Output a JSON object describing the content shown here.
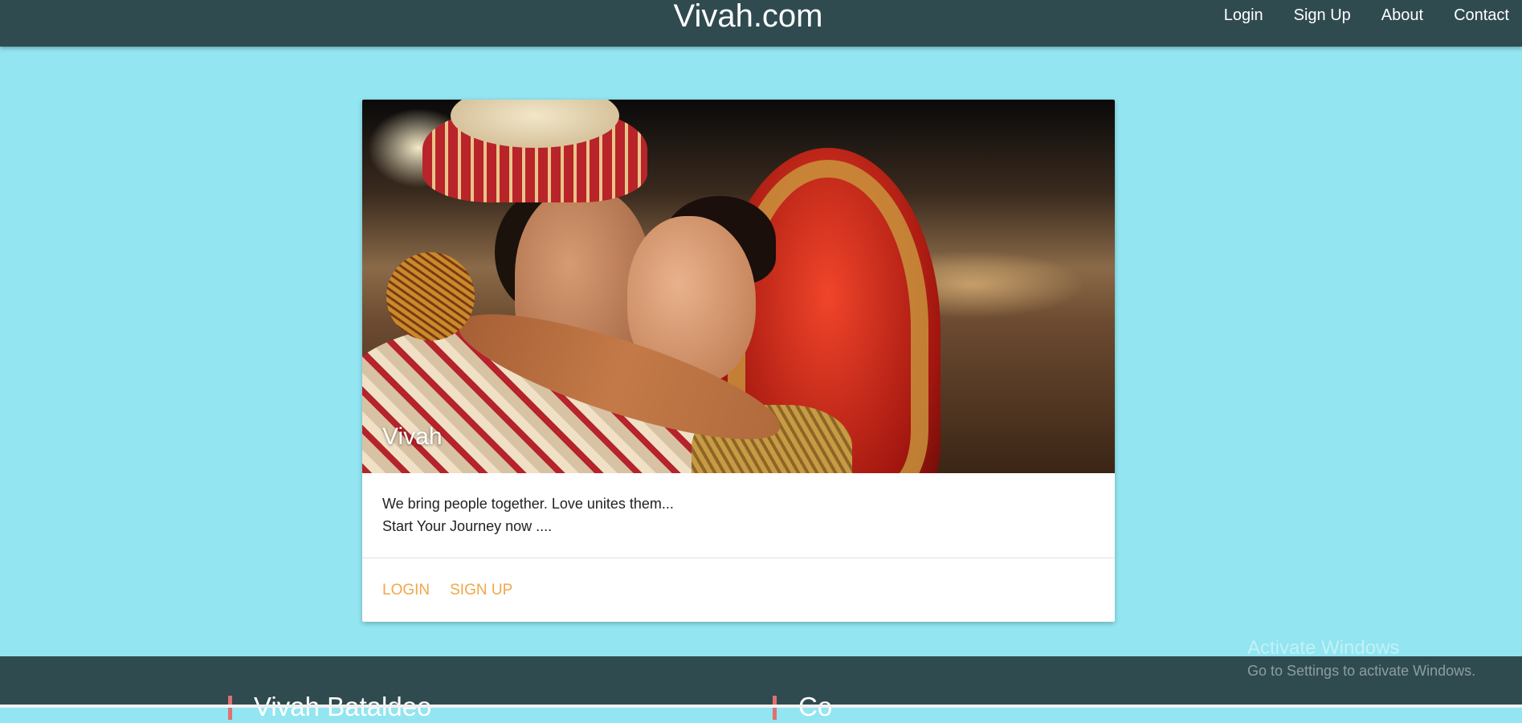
{
  "navbar": {
    "brand": "Vivah.com",
    "links": [
      "Login",
      "Sign Up",
      "About",
      "Contact"
    ]
  },
  "card": {
    "image_alt": "Bride and groom smiling at each other",
    "title": "Vivah",
    "lines": [
      "We bring people together. Love unites them...",
      "Start Your Journey now ...."
    ],
    "actions": [
      "Login",
      "Sign Up"
    ]
  },
  "footer": {
    "left_heading": "Vivah Bataldeo",
    "right_heading": "Co"
  },
  "watermark": {
    "line1": "Activate Windows",
    "line2": "Go to Settings to activate Windows."
  },
  "colors": {
    "navbar": "#2f4b4f",
    "background": "#92e5f1",
    "accent": "#f0a84a"
  }
}
